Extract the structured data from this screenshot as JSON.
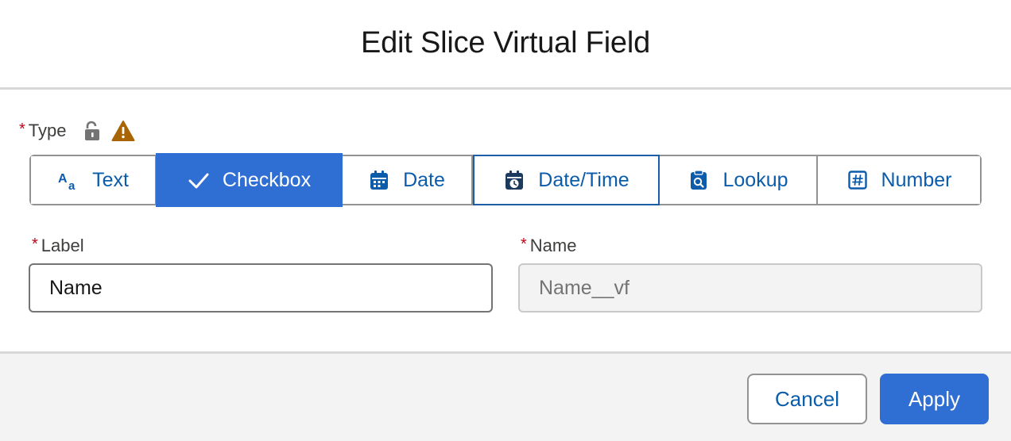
{
  "dialog": {
    "title": "Edit Slice Virtual Field"
  },
  "type_field": {
    "required_mark": "*",
    "label": "Type",
    "icons": [
      "unlock-icon",
      "warning-icon"
    ],
    "warning_color": "#a96404",
    "options": [
      {
        "label": "Text",
        "icon": "text-icon",
        "state": "default"
      },
      {
        "label": "Checkbox",
        "icon": "check-icon",
        "state": "selected"
      },
      {
        "label": "Date",
        "icon": "calendar-icon",
        "state": "default"
      },
      {
        "label": "Date/Time",
        "icon": "calendar-clock-icon",
        "state": "focused"
      },
      {
        "label": "Lookup",
        "icon": "lookup-icon",
        "state": "default"
      },
      {
        "label": "Number",
        "icon": "number-icon",
        "state": "default"
      }
    ]
  },
  "label_field": {
    "required_mark": "*",
    "label": "Label",
    "value": "Name"
  },
  "name_field": {
    "required_mark": "*",
    "label": "Name",
    "value": "Name__vf",
    "disabled": true
  },
  "footer": {
    "cancel_label": "Cancel",
    "apply_label": "Apply"
  },
  "colors": {
    "brand": "#2f6ed3",
    "link": "#0b5cab",
    "required": "#ba0517"
  }
}
